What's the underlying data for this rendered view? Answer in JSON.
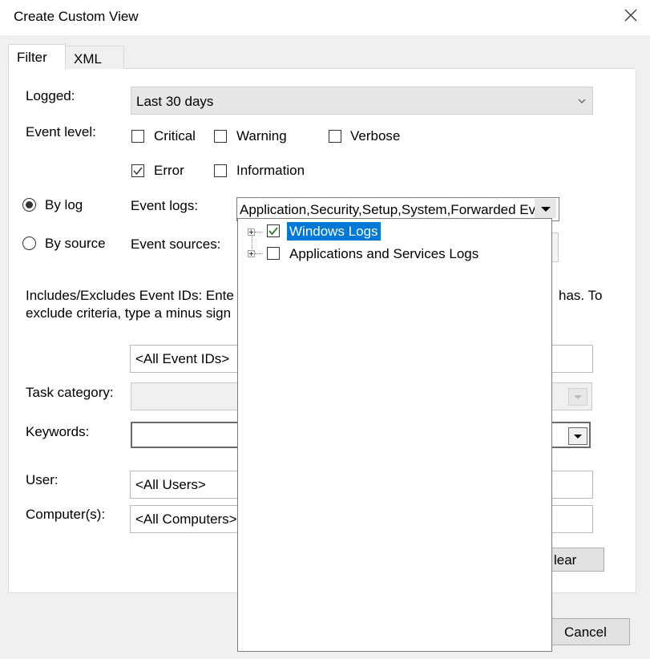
{
  "window": {
    "title": "Create Custom View",
    "close_icon": "close-icon"
  },
  "tabs": [
    {
      "label": "Filter",
      "active": true
    },
    {
      "label": "XML",
      "active": false
    }
  ],
  "filter": {
    "logged_label": "Logged:",
    "logged_value": "Last 30 days",
    "event_level_label": "Event level:",
    "levels": {
      "critical": {
        "label": "Critical",
        "checked": false
      },
      "warning": {
        "label": "Warning",
        "checked": false
      },
      "verbose": {
        "label": "Verbose",
        "checked": false
      },
      "error": {
        "label": "Error",
        "checked": true
      },
      "information": {
        "label": "Information",
        "checked": false
      }
    },
    "by_log_label": "By log",
    "by_source_label": "By source",
    "event_logs_label": "Event logs:",
    "event_logs_value": "Application,Security,Setup,System,Forwarded Ev",
    "event_sources_label": "Event sources:",
    "event_ids_text_line1": "Includes/Excludes Event IDs: Ente",
    "event_ids_text_line1_right": "has. To",
    "event_ids_text_line2": "exclude criteria, type a minus sign",
    "event_ids_placeholder": "<All Event IDs>",
    "task_category_label": "Task category:",
    "keywords_label": "Keywords:",
    "user_label": "User:",
    "user_value": "<All Users>",
    "computers_label": "Computer(s):",
    "computers_value": "<All Computers>",
    "clear_button": "lear"
  },
  "dropdown_tree": [
    {
      "label": "Windows Logs",
      "checked": true,
      "selected": true
    },
    {
      "label": "Applications and Services Logs",
      "checked": false,
      "selected": false
    }
  ],
  "footer": {
    "cancel_button": "Cancel"
  },
  "colors": {
    "selection": "#0078d7",
    "check": "#2b7a2b"
  }
}
